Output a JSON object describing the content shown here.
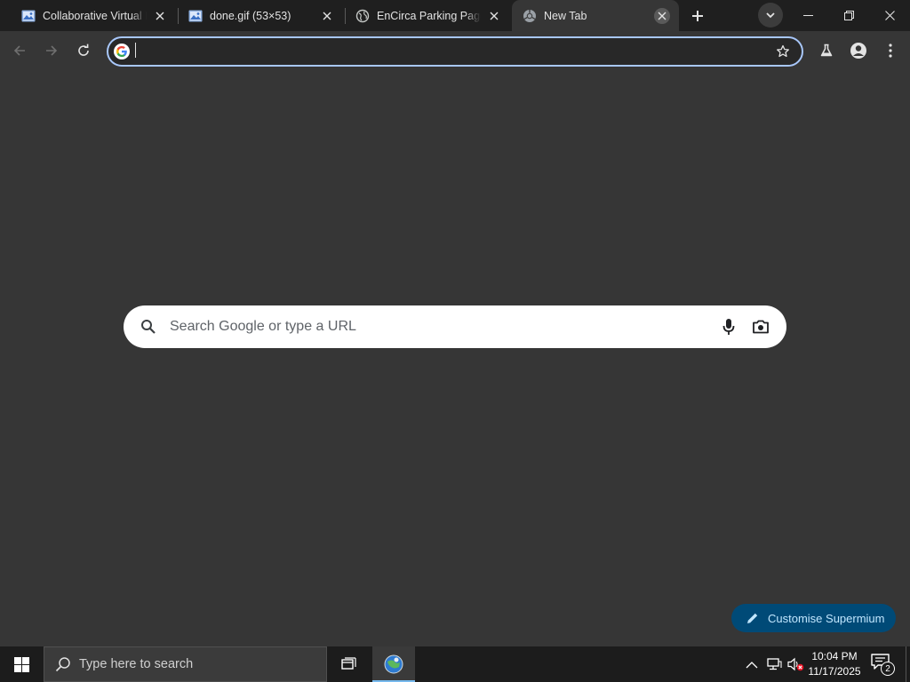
{
  "browser": {
    "tabs": [
      {
        "title": "Collaborative Virtual M",
        "favicon": "image-file-icon",
        "active": false
      },
      {
        "title": "done.gif (53×53)",
        "favicon": "image-file-icon",
        "active": false
      },
      {
        "title": "EnCirca Parking Page",
        "favicon": "globe-icon",
        "active": false
      },
      {
        "title": "New Tab",
        "favicon": "chromium-icon",
        "active": true
      }
    ],
    "omnibox": {
      "value": "",
      "placeholder": ""
    }
  },
  "ntp": {
    "search_placeholder": "Search Google or type a URL",
    "customise_label": "Customise Supermium"
  },
  "taskbar": {
    "search_placeholder": "Type here to search",
    "time": "10:04 PM",
    "date": "11/17/2025",
    "notification_count": "2"
  },
  "colors": {
    "accent": "#a8c7fa",
    "page_background": "#363636",
    "tabstrip_background": "#1f1f1f",
    "customise_button": "#004a77",
    "taskbar": "#1c1c1c"
  }
}
